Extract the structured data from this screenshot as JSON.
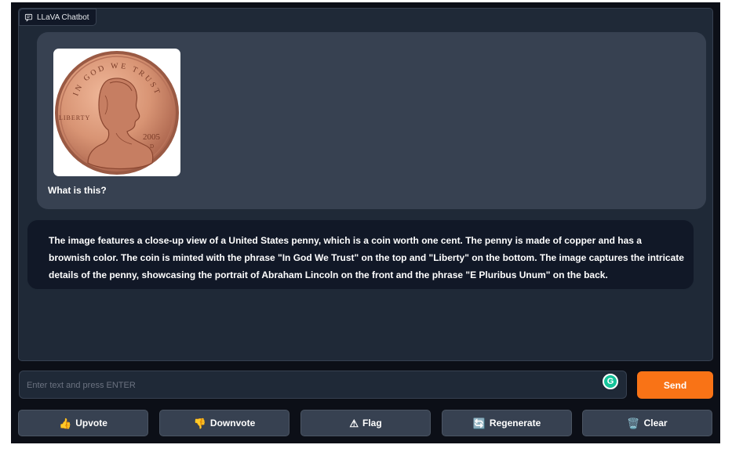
{
  "chatbot": {
    "label": "LLaVA Chatbot",
    "label_icon": "chat-icon"
  },
  "messages": {
    "user_text": "What is this?",
    "user_image": {
      "alt": "penny",
      "coin_top_text": "IN GOD WE TRUST",
      "coin_left_text": "LIBERTY",
      "coin_year": "2005",
      "coin_mint": "D"
    },
    "bot_text": "The image features a close-up view of a United States penny, which is a coin worth one cent. The penny is made of copper and has a brownish color. The coin is minted with the phrase \"In God We Trust\" on the top and \"Liberty\" on the bottom. The image captures the intricate details of the penny, showcasing the portrait of Abraham Lincoln on the front and the phrase \"E Pluribus Unum\" on the back."
  },
  "input": {
    "placeholder": "Enter text and press ENTER",
    "value": "",
    "grammarly_glyph": "G"
  },
  "send_label": "Send",
  "actions": {
    "upvote": {
      "icon": "👍",
      "label": "Upvote"
    },
    "downvote": {
      "icon": "👎",
      "label": "Downvote"
    },
    "flag": {
      "icon": "⚠",
      "label": "Flag"
    },
    "regenerate": {
      "icon": "🔄",
      "label": "Regenerate"
    },
    "clear": {
      "icon": "🗑️",
      "label": "Clear"
    }
  },
  "colors": {
    "accent": "#f97316",
    "panel": "#1f2937",
    "bubble_user": "#374151",
    "bubble_bot": "#111827"
  }
}
